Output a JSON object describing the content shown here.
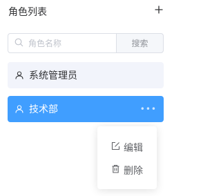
{
  "header": {
    "title": "角色列表",
    "add_icon": "plus-icon"
  },
  "search": {
    "placeholder": "角色名称",
    "value": "",
    "button_label": "搜索",
    "icon": "search-icon"
  },
  "roles": [
    {
      "label": "系统管理员",
      "icon": "user-icon",
      "active": false
    },
    {
      "label": "技术部",
      "icon": "user-icon",
      "active": true,
      "more": "•••"
    }
  ],
  "context_menu": {
    "items": [
      {
        "label": "编辑",
        "icon": "edit-icon"
      },
      {
        "label": "删除",
        "icon": "trash-icon"
      }
    ]
  },
  "colors": {
    "active_bg": "#409eff",
    "item_bg": "#f2f4fb",
    "border": "#dcdfe6",
    "placeholder": "#c0c4cc"
  }
}
